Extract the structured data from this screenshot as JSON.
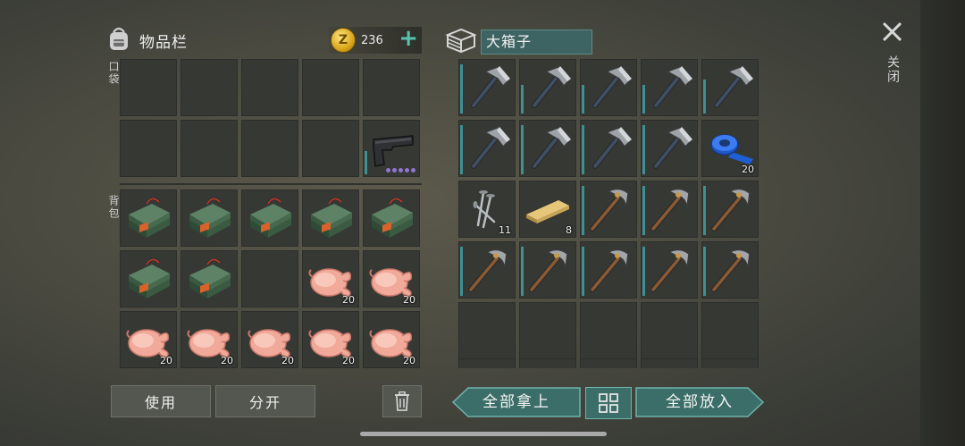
{
  "inventory": {
    "title": "物品栏",
    "icon": "backpack-icon",
    "coins": "236",
    "coin_symbol": "Z",
    "pocket_label": "口袋",
    "backpack_label": "背包",
    "pockets": [
      {
        "item": ""
      },
      {
        "item": ""
      },
      {
        "item": ""
      },
      {
        "item": ""
      },
      {
        "item": ""
      },
      {
        "item": ""
      },
      {
        "item": ""
      },
      {
        "item": ""
      },
      {
        "item": ""
      },
      {
        "item": "pistol",
        "durability": 0.45,
        "dots": 5
      }
    ],
    "backpack": [
      {
        "item": "explosive",
        "count": ""
      },
      {
        "item": "explosive",
        "count": ""
      },
      {
        "item": "explosive",
        "count": ""
      },
      {
        "item": "explosive",
        "count": ""
      },
      {
        "item": "explosive",
        "count": ""
      },
      {
        "item": "explosive",
        "count": ""
      },
      {
        "item": "explosive",
        "count": ""
      },
      {
        "item": "",
        "count": ""
      },
      {
        "item": "chicken",
        "count": "20"
      },
      {
        "item": "chicken",
        "count": "20"
      },
      {
        "item": "chicken",
        "count": "20"
      },
      {
        "item": "chicken",
        "count": "20"
      },
      {
        "item": "chicken",
        "count": "20"
      },
      {
        "item": "chicken",
        "count": "20"
      },
      {
        "item": "chicken",
        "count": "20"
      }
    ]
  },
  "chest": {
    "title": "大箱子",
    "icon": "chest-icon",
    "slots": [
      {
        "item": "hatchet",
        "count": "",
        "durability": 0.95
      },
      {
        "item": "hatchet",
        "count": "",
        "durability": 0.55
      },
      {
        "item": "hatchet",
        "count": "",
        "durability": 0.55
      },
      {
        "item": "hatchet",
        "count": "",
        "durability": 0.55
      },
      {
        "item": "hatchet",
        "count": "",
        "durability": 0.65
      },
      {
        "item": "hatchet",
        "count": "",
        "durability": 0.95
      },
      {
        "item": "hatchet",
        "count": "",
        "durability": 0.95
      },
      {
        "item": "hatchet",
        "count": "",
        "durability": 0.95
      },
      {
        "item": "hatchet",
        "count": "",
        "durability": 0.95
      },
      {
        "item": "duct-tape",
        "count": "20"
      },
      {
        "item": "nails",
        "count": "11"
      },
      {
        "item": "plank",
        "count": "8"
      },
      {
        "item": "pickaxe",
        "count": "",
        "durability": 0.95
      },
      {
        "item": "pickaxe",
        "count": "",
        "durability": 0.95
      },
      {
        "item": "pickaxe",
        "count": "",
        "durability": 0.95
      },
      {
        "item": "pickaxe",
        "count": "",
        "durability": 0.95
      },
      {
        "item": "pickaxe",
        "count": "",
        "durability": 0.95
      },
      {
        "item": "pickaxe",
        "count": "",
        "durability": 0.95
      },
      {
        "item": "pickaxe",
        "count": "",
        "durability": 0.95
      },
      {
        "item": "pickaxe",
        "count": "",
        "durability": 0.95
      },
      {
        "item": "",
        "count": ""
      },
      {
        "item": "",
        "count": ""
      },
      {
        "item": "",
        "count": ""
      },
      {
        "item": "",
        "count": ""
      },
      {
        "item": "",
        "count": ""
      }
    ]
  },
  "buttons": {
    "use": "使用",
    "split": "分开",
    "take_all": "全部拿上",
    "put_all": "全部放入",
    "close": "关闭"
  },
  "colors": {
    "accent_teal": "#3b6e69",
    "durability_bar": "#3f8f94",
    "coin_plus": "#57c2ae"
  }
}
